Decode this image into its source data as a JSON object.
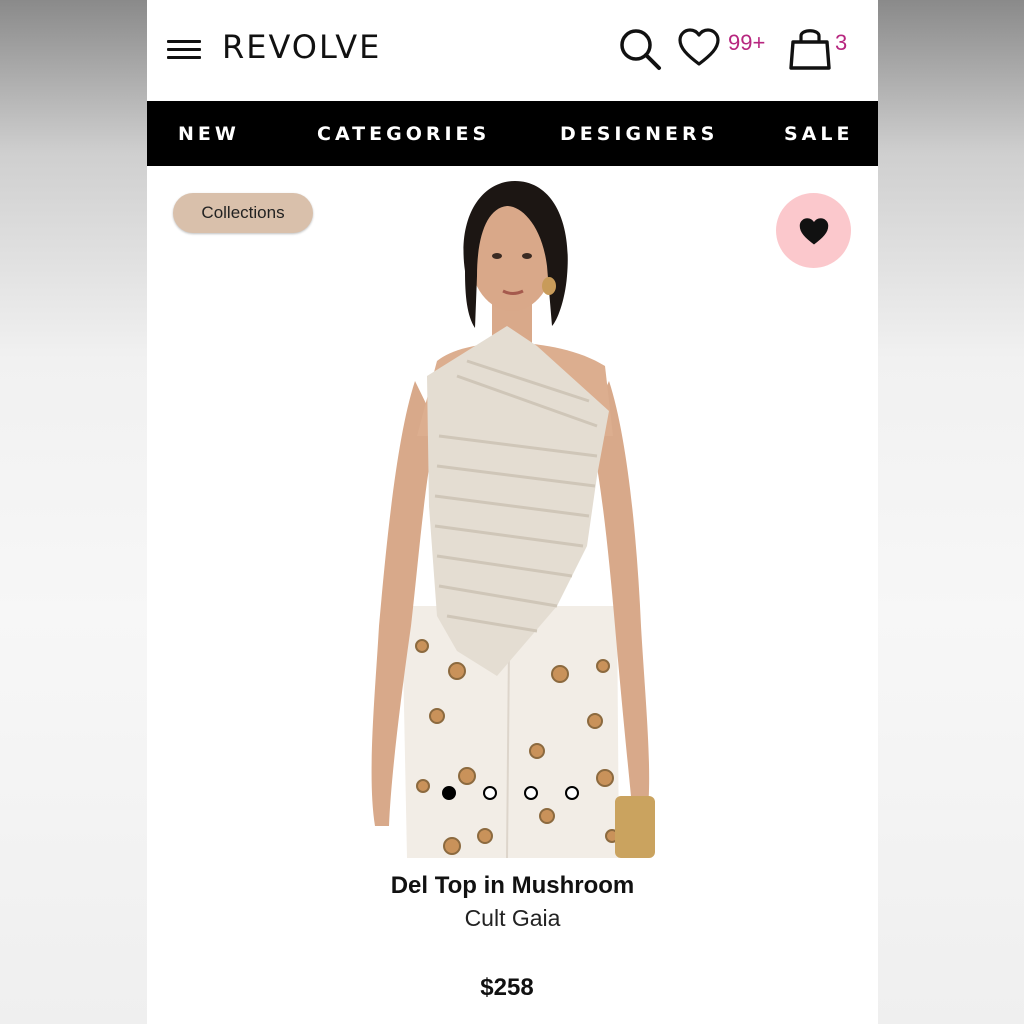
{
  "header": {
    "logo": "REVOLVE",
    "wishlist_count": "99+",
    "cart_count": "3",
    "accent_color": "#b7267f"
  },
  "nav": {
    "items": [
      "NEW",
      "CATEGORIES",
      "DESIGNERS",
      "SALE"
    ]
  },
  "product": {
    "collections_label": "Collections",
    "name": "Del Top in Mushroom",
    "brand": "Cult Gaia",
    "price": "$258",
    "image_count": 4,
    "active_image_index": 0,
    "favorite_button_color": "#fbc8cc",
    "chip_color": "#d9c0ab"
  },
  "icons": {
    "menu": "hamburger-icon",
    "search": "search-icon",
    "wishlist": "heart-outline-icon",
    "cart": "shopping-bag-icon",
    "favorite": "heart-filled-icon"
  }
}
